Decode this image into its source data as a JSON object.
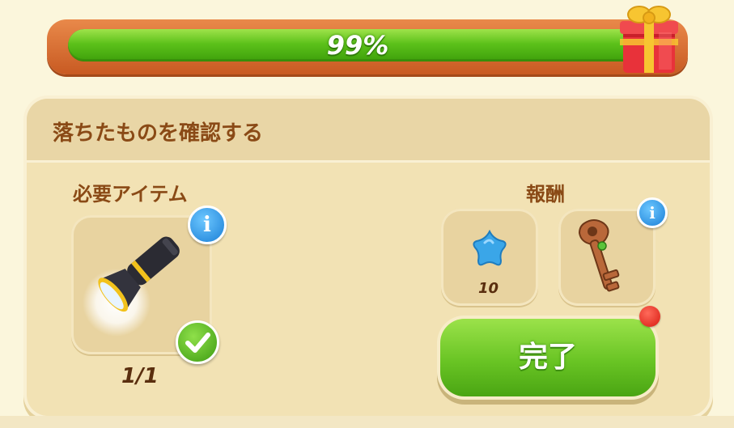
{
  "progress": {
    "percent_label": "99%",
    "value": 0.99,
    "fill_color": "#5cc11a",
    "frame_color": "#d86e30"
  },
  "reward_chest": {
    "icon": "gift-box-icon"
  },
  "panel": {
    "title": "落ちたものを確認する",
    "required": {
      "label": "必要アイテム",
      "item_icon": "flashlight-icon",
      "count": "1/1",
      "complete": true
    },
    "rewards": {
      "label": "報酬",
      "items": [
        {
          "icon": "blue-star-icon",
          "count": "10"
        },
        {
          "icon": "antique-key-icon"
        }
      ]
    },
    "done_button": {
      "label": "完了",
      "color": "#69c424"
    }
  },
  "colors": {
    "background": "#fbf6dc",
    "panel": "#f2e2b4",
    "title_text": "#8a4a16",
    "info_blue": "#1b7fd6",
    "notify_red": "#d81b12"
  }
}
